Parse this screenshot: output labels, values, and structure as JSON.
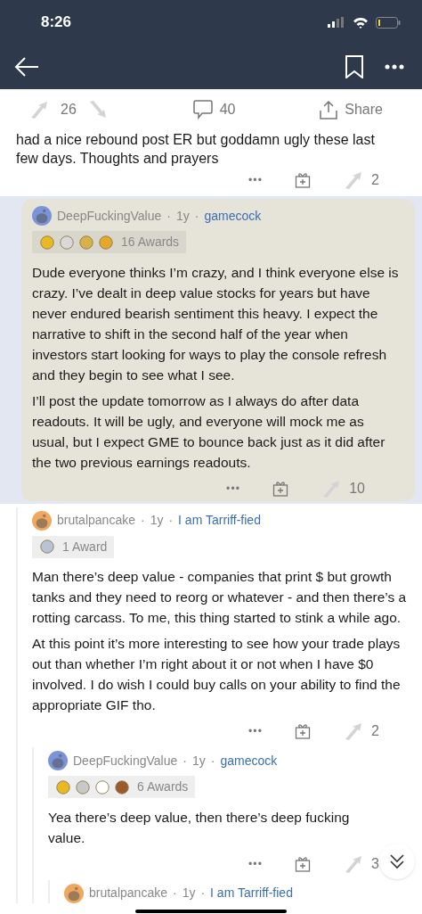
{
  "status_bar": {
    "time": "8:26"
  },
  "post": {
    "upvotes": "26",
    "comments": "40",
    "share": "Share",
    "body": "had a nice rebound post ER but goddamn ugly these last few days. Thoughts and prayers",
    "more": "•••",
    "votes": "2"
  },
  "comments": [
    {
      "author": "DeepFuckingValue",
      "separators": [
        "·",
        "·"
      ],
      "age": "1y",
      "flair": "gamecock",
      "highlighted": true,
      "avatar": {
        "color": "#7b93d9"
      },
      "awards": {
        "label": "16 Awards",
        "icons": [
          {
            "color": "#e9b923"
          },
          {
            "color": "#d9d9d9"
          },
          {
            "color": "#d7b24a"
          },
          {
            "color": "#e2a92a"
          }
        ]
      },
      "paragraphs": [
        "Dude everyone thinks I’m crazy, and I think everyone else is crazy. I’ve dealt in deep value stocks for years but have never endured bearish sentiment this heavy. I expect the narrative to shift in the second half of the year when investors start looking for ways to play the console refresh and they begin to see what I see.",
        "I’ll post the update tomorrow as I always do after data readouts. It will be ugly, and everyone will mock me as usual, but I expect GME to bounce back just as it did after the two previous earnings readouts."
      ],
      "more": "•••",
      "votes": "10",
      "children": [
        {
          "author": "brutalpancake",
          "separators": [
            "·",
            "·"
          ],
          "age": "1y",
          "flair": "I am Tarriff-fied",
          "highlighted": false,
          "avatar": {
            "color": "#f0a860"
          },
          "awards": {
            "label": "1 Award",
            "icons": [
              {
                "color": "#b8c4d4"
              }
            ]
          },
          "paragraphs": [
            "Man there’s deep value - companies that print $ but growth tanks and they need to reorg or whatever - and then there’s a rotting carcass. To me, this thing started to stink a while ago.",
            "At this point it’s more interesting to see how your trade plays out than whether I’m right about it or not when I have $0 involved. I do wish I could buy calls on your ability to find the appropriate GIF tho."
          ],
          "more": "•••",
          "votes": "2",
          "children": [
            {
              "author": "DeepFuckingValue",
              "separators": [
                "·",
                "·"
              ],
              "age": "1y",
              "flair": "gamecock",
              "highlighted": false,
              "avatar": {
                "color": "#7b93d9"
              },
              "awards": {
                "label": "6 Awards",
                "icons": [
                  {
                    "color": "#e9b923"
                  },
                  {
                    "color": "#c8c8c8"
                  },
                  {
                    "color": "#ffffff"
                  },
                  {
                    "color": "#9a5a2c"
                  }
                ]
              },
              "paragraphs": [
                "Yea there’s deep value, then there’s deep fucking value."
              ],
              "more": "•••",
              "votes": "3",
              "children": [
                {
                  "author": "brutalpancake",
                  "separators": [
                    "·",
                    "·"
                  ],
                  "age": "1y",
                  "flair": "I am Tarriff-fied",
                  "highlighted": false,
                  "avatar": {
                    "color": "#f0a860"
                  }
                }
              ]
            }
          ]
        }
      ]
    }
  ]
}
